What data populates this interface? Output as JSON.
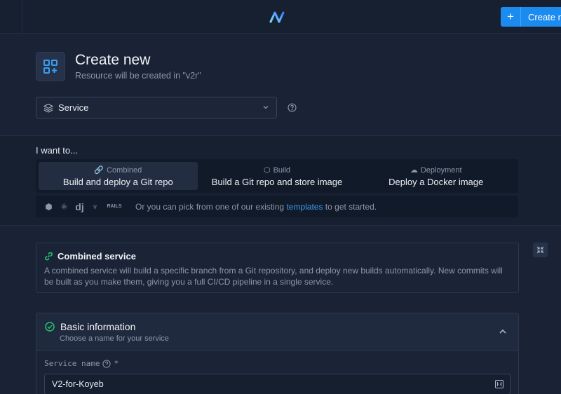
{
  "topbar": {
    "create_label": "Create ne",
    "plus": "+"
  },
  "header": {
    "title": "Create new",
    "subtitle": "Resource will be created in \"v2r\""
  },
  "resource_select": {
    "value": "Service"
  },
  "intent": {
    "label": "I want to...",
    "tabs": [
      {
        "small": "Combined",
        "big": "Build and deploy a Git repo",
        "active": true
      },
      {
        "small": "Build",
        "big": "Build a Git repo and store image",
        "active": false
      },
      {
        "small": "Deployment",
        "big": "Deploy a Docker image",
        "active": false
      }
    ],
    "templates": {
      "icons": [
        "nodejs-icon",
        "react-icon",
        "django-icon",
        "laravel-icon",
        "rails-icon"
      ],
      "django_text": "dj",
      "rails_text": "RAILS",
      "prefix": "Or you can pick from one of our existing ",
      "link": "templates",
      "suffix": " to get started."
    }
  },
  "combined_card": {
    "title": "Combined service",
    "description": "A combined service will build a specific branch from a Git repository, and deploy new builds automatically. New commits will be built as you make them, giving you a full CI/CD pipeline in a single service."
  },
  "basic_info": {
    "title": "Basic information",
    "subtitle": "Choose a name for your service",
    "field_label": "Service name",
    "required_mark": "*",
    "field_value": "V2-for-Koyeb"
  },
  "colors": {
    "accent": "#1b8bf0",
    "link": "#3b9cf0",
    "success": "#27c46f"
  }
}
